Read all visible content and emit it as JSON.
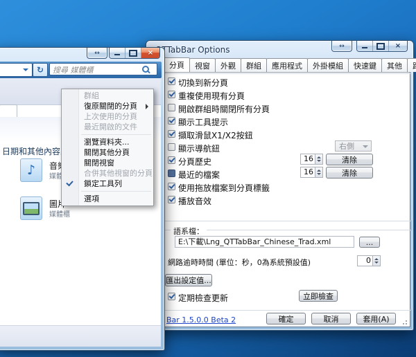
{
  "colors": {
    "desktop_top": "#2e8fdd",
    "desktop_bottom": "#0b3c74",
    "glass_frame": "#a4c4e2",
    "close_button_red": "#d4502c",
    "check_blue": "#3465a8",
    "link_blue": "#1c45c9"
  },
  "explorer_window": {
    "search": {
      "placeholder": "搜尋 媒體櫃"
    },
    "icons": {
      "refresh": "↻",
      "music_note": "♪"
    },
    "content": {
      "header_text": "日期和其他內容來排列",
      "items": [
        {
          "label": "音樂",
          "sublabel": "媒體櫃"
        },
        {
          "label": "圖片",
          "sublabel": "媒體櫃"
        }
      ]
    }
  },
  "context_menu": {
    "items": [
      {
        "label": "群組",
        "disabled": true
      },
      {
        "label": "復原關閉的分頁",
        "submenu": true
      },
      {
        "label": "上次使用的分頁",
        "disabled": true
      },
      {
        "label": "最近開啟的文件",
        "disabled": true
      },
      {
        "separator": true
      },
      {
        "label": "瀏覽資料夾..."
      },
      {
        "label": "關閉其他分頁"
      },
      {
        "label": "關閉視窗"
      },
      {
        "label": "合併其他視窗的分頁",
        "disabled": true
      },
      {
        "label": "鎖定工具列",
        "checked": true
      },
      {
        "separator": true
      },
      {
        "label": "選項"
      }
    ]
  },
  "options_dialog": {
    "title": "QTTabBar Options",
    "tabs": [
      "分頁",
      "視窗",
      "外觀",
      "群組",
      "應用程式",
      "外掛模組",
      "快速鍵",
      "其他",
      "路徑"
    ],
    "selected_tab": "分頁",
    "checkbox_rows": [
      {
        "label": "切換到新分頁",
        "state": "checked"
      },
      {
        "label": "重複使用現有分頁",
        "state": "checked"
      },
      {
        "label": "開啟群組時關閉所有分頁",
        "state": "unchecked"
      },
      {
        "label": "顯示工具提示",
        "state": "checked"
      },
      {
        "label": "擷取滑鼠X1/X2按鈕",
        "state": "checked"
      },
      {
        "label": "顯示導航鈕",
        "state": "unchecked",
        "control": {
          "type": "dropdown",
          "value": "右側",
          "disabled": true
        }
      },
      {
        "label": "分頁歷史",
        "state": "checked",
        "control": {
          "type": "spinner-button",
          "value": "16",
          "button": "清除"
        }
      },
      {
        "label": "最近的檔案",
        "state": "mixed",
        "control": {
          "type": "spinner-button",
          "value": "16",
          "button": "清除"
        }
      },
      {
        "label": "使用拖放檔案到分頁標籤",
        "state": "checked"
      },
      {
        "label": "播放音效",
        "state": "checked"
      }
    ],
    "language_group": {
      "title": "語系檔：",
      "file_path": "E:\\下載\\Lng_QTTabBar_Chinese_Trad.xml",
      "browse_label": "...",
      "timeout_label": "網路逾時時間 (單位：秒，0為系統預設值)",
      "timeout_value": "0",
      "export_button": "匯出設定值...",
      "update_check_label": "定期檢查更新",
      "update_check_state": "checked",
      "check_now_button": "立即檢查"
    },
    "footer": {
      "version_link": "Bar 1.5.0.0 Beta 2",
      "ok": "確定",
      "cancel": "取消",
      "apply": "套用(A)"
    }
  }
}
